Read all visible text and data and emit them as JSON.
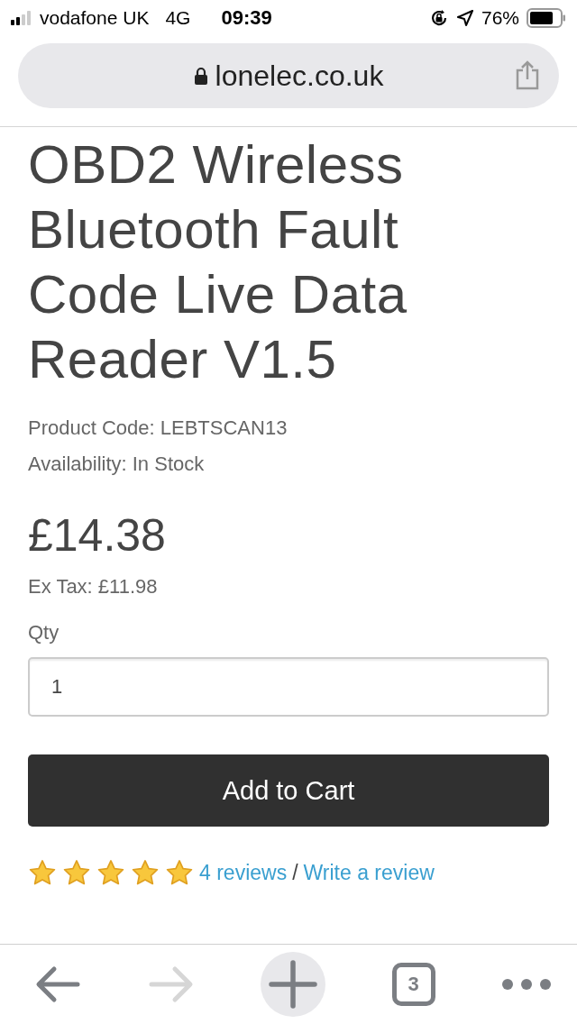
{
  "status_bar": {
    "carrier": "vodafone UK",
    "network": "4G",
    "time": "09:39",
    "battery": "76%"
  },
  "address_bar": {
    "url": "lonelec.co.uk"
  },
  "product": {
    "title": "OBD2 Wireless Bluetooth Fault Code Live Data Reader V1.5",
    "product_code": "Product Code: LEBTSCAN13",
    "availability": "Availability: In Stock",
    "price": "£14.38",
    "ex_tax": "Ex Tax: £11.98",
    "qty_label": "Qty",
    "qty_value": "1",
    "add_button": "Add to Cart",
    "stars": 5,
    "reviews_link": "4 reviews",
    "separator": "/",
    "write_review_link": "Write a review"
  },
  "toolbar": {
    "back": {
      "disabled": false
    },
    "forward": {
      "disabled": true
    },
    "tabs_count": "3"
  }
}
